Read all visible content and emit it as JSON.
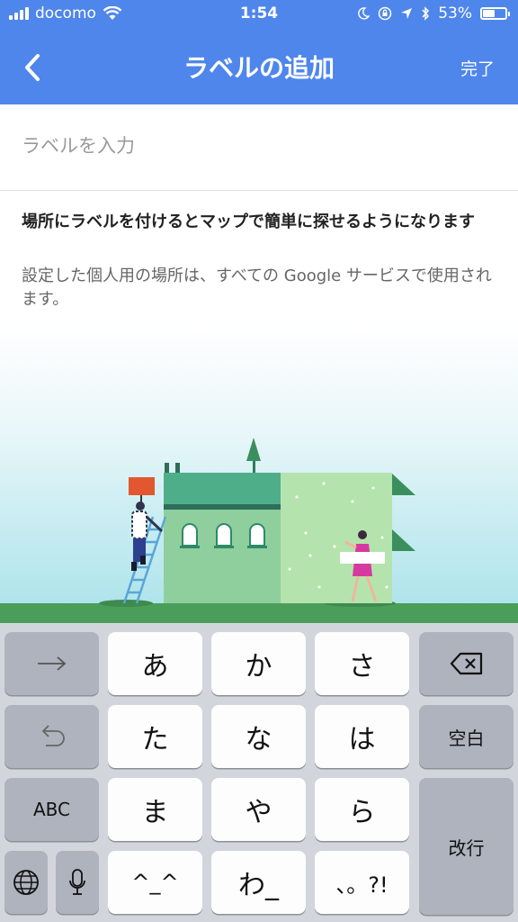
{
  "status_bar": {
    "carrier": "docomo",
    "time": "1:54",
    "battery": "53%",
    "battery_level": 0.53
  },
  "app_bar": {
    "title": "ラベルの追加",
    "done_label": "完了"
  },
  "label_input": {
    "placeholder": "ラベルを入力",
    "value": ""
  },
  "info": {
    "heading": "場所にラベルを付けるとマップで簡単に探せるようになります",
    "description": "設定した個人用の場所は、すべての Google サービスで使用されます。"
  },
  "keyboard": {
    "keys": {
      "a": "あ",
      "ka": "か",
      "sa": "さ",
      "ta": "た",
      "na": "な",
      "ha": "は",
      "ma": "ま",
      "ya": "や",
      "ra": "ら",
      "kaomoji": "^_^",
      "wa": "わ_",
      "punct": "、。?!",
      "space": "空白",
      "abc": "ABC",
      "enter": "改行"
    }
  },
  "colors": {
    "primary": "#4f86ec",
    "keyboard_bg": "#d2d5dc",
    "key_light": "#fdfdfd",
    "key_dark": "#aeb3bd"
  }
}
